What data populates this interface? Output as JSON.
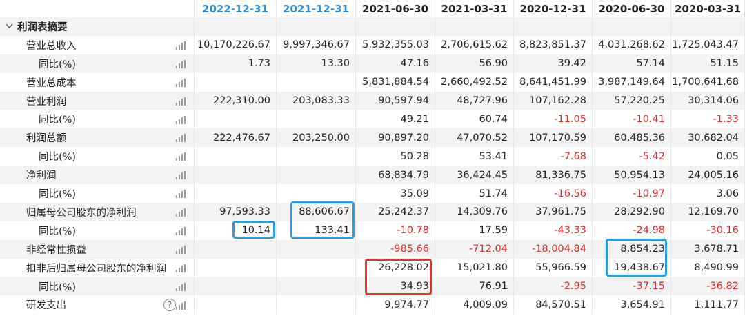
{
  "headers": [
    "",
    "2022-12-31",
    "2021-12-31",
    "2021-06-30",
    "2021-03-31",
    "2020-12-31",
    "2020-06-30",
    "2020-03-31"
  ],
  "section": "利润表摘要",
  "rows": [
    {
      "label": "营业总收入",
      "values": [
        "10,170,226.67",
        "9,997,346.67",
        "5,932,355.03",
        "2,706,615.62",
        "8,823,851.37",
        "4,031,268.62",
        "1,725,043.47"
      ]
    },
    {
      "label": "同比(%)",
      "values": [
        "1.73",
        "13.30",
        "47.16",
        "56.90",
        "39.42",
        "57.14",
        "51.15"
      ]
    },
    {
      "label": "营业总成本",
      "values": [
        "",
        "",
        "5,831,884.54",
        "2,660,492.52",
        "8,641,451.99",
        "3,987,149.64",
        "1,700,641.68"
      ]
    },
    {
      "label": "营业利润",
      "values": [
        "222,310.00",
        "203,083.33",
        "90,597.94",
        "48,727.96",
        "107,162.28",
        "57,220.25",
        "30,314.06"
      ]
    },
    {
      "label": "同比(%)",
      "values": [
        "",
        "",
        "49.21",
        "60.74",
        "-11.05",
        "-10.41",
        "-1.33"
      ]
    },
    {
      "label": "利润总额",
      "values": [
        "222,476.67",
        "203,250.00",
        "90,897.20",
        "47,070.52",
        "107,170.59",
        "60,485.36",
        "30,682.04"
      ]
    },
    {
      "label": "同比(%)",
      "values": [
        "",
        "",
        "50.28",
        "53.41",
        "-7.68",
        "-5.42",
        "0.05"
      ]
    },
    {
      "label": "净利润",
      "values": [
        "",
        "",
        "68,834.79",
        "36,424.45",
        "81,336.75",
        "50,954.13",
        "24,005.16"
      ]
    },
    {
      "label": "同比(%)",
      "values": [
        "",
        "",
        "35.09",
        "51.74",
        "-16.56",
        "-10.97",
        "3.06"
      ]
    },
    {
      "label": "归属母公司股东的净利润",
      "values": [
        "97,593.33",
        "88,606.67",
        "25,242.37",
        "14,309.76",
        "37,961.75",
        "28,292.90",
        "12,169.70"
      ]
    },
    {
      "label": "同比(%)",
      "values": [
        "10.14",
        "133.41",
        "-10.78",
        "17.59",
        "-43.33",
        "-24.98",
        "-30.16"
      ]
    },
    {
      "label": "非经常性损益",
      "values": [
        "",
        "",
        "-985.66",
        "-712.04",
        "-18,004.84",
        "8,854.23",
        "3,678.71"
      ]
    },
    {
      "label": "扣非后归属母公司股东的净利润",
      "values": [
        "",
        "",
        "26,228.02",
        "15,021.80",
        "55,966.59",
        "19,438.67",
        "8,490.99"
      ]
    },
    {
      "label": "同比(%)",
      "values": [
        "",
        "",
        "34.93",
        "76.91",
        "-2.95",
        "-37.15",
        "-36.82"
      ]
    },
    {
      "label": "研发支出",
      "values": [
        "",
        "",
        "9,974.77",
        "4,009.09",
        "84,570.51",
        "3,654.91",
        "1,111.77"
      ]
    }
  ],
  "colors": {
    "forecast_header": "#2b8ed8",
    "negative": "#e0292b",
    "highlight_blue": "#2b9be9",
    "highlight_red": "#e8302a"
  },
  "icons": {
    "section_toggle": "chevron-down-icon",
    "row_chart": "bar-chart-icon",
    "help": "help-circle-icon"
  },
  "help_symbol": "?"
}
